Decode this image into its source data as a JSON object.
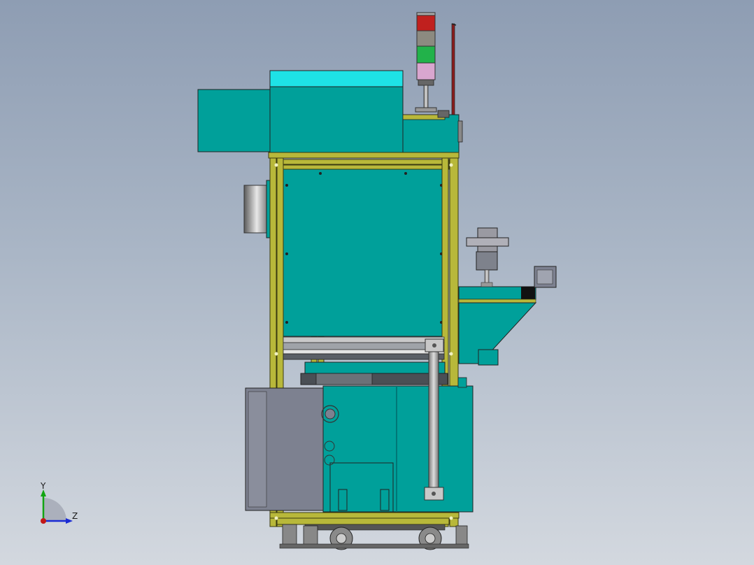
{
  "viewport": {
    "description_visible": false,
    "colors": {
      "background_top": "#8e9db3",
      "background_bottom": "#d3d8df",
      "cabinet_teal": "#00a09a",
      "frame_yellow": "#b8b83a",
      "cyan_cover": "#1ee2e6",
      "panel_gray": "#7d8190",
      "light_red": "#c0201e",
      "light_amber": "#8c8a80",
      "light_green": "#22b24a",
      "light_pink": "#d9a6cf"
    }
  },
  "triad": {
    "y_label": "Y",
    "z_label": "Z",
    "icon": "coordinate-triad-icon"
  },
  "model": {
    "icon": "machine-assembly-side-view"
  }
}
